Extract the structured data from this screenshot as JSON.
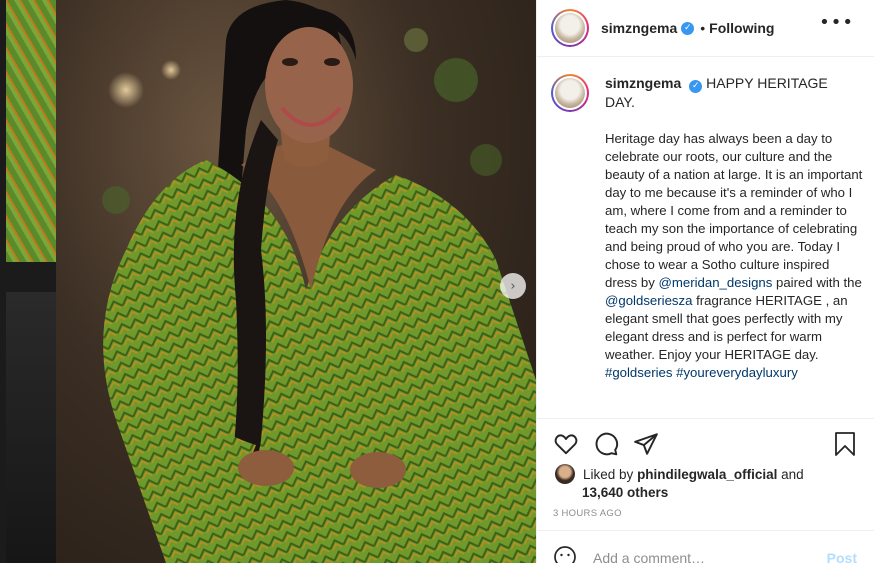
{
  "post": {
    "username": "simzngema",
    "follow_status": "Following",
    "separator": "•",
    "more": "•••",
    "next_arrow": "›"
  },
  "caption": {
    "username": "simzngema",
    "headline": "HAPPY HERITAGE DAY.",
    "segments": [
      {
        "text": "Heritage day has always been a day to celebrate our roots, our culture and the beauty of a nation at large. It is an important day to me because it's a reminder of who I am, where I come from and a reminder to teach my son the importance of celebrating and being proud of who you are. Today I chose to wear a Sotho culture inspired dress by ",
        "link": false
      },
      {
        "text": "@meridan_designs",
        "link": true
      },
      {
        "text": " paired with the ",
        "link": false
      },
      {
        "text": "@goldseriesza",
        "link": true
      },
      {
        "text": " fragrance HERITAGE , an elegant smell that goes perfectly with my elegant dress and is perfect for warm weather. Enjoy your HERITAGE day. ",
        "link": false
      },
      {
        "text": "#goldseries",
        "link": true
      },
      {
        "text": " ",
        "link": false
      },
      {
        "text": "#youreverydayluxury",
        "link": true
      }
    ]
  },
  "likes": {
    "prefix": "Liked by",
    "liker": "phindilegwala_official",
    "and": "and",
    "count": "13,640 others"
  },
  "timestamp": "3 HOURS AGO",
  "comment": {
    "placeholder": "Add a comment…",
    "post_label": "Post"
  },
  "icons": {
    "like": "heart-icon",
    "comment": "comment-icon",
    "share": "paper-plane-icon",
    "save": "bookmark-icon",
    "emoji": "emoji-icon",
    "verified": "verified-badge-icon"
  },
  "colors": {
    "link": "#00376b",
    "verified": "#3897f0",
    "post_button": "#b2dffc",
    "dress_green": "#6f9a2b"
  }
}
